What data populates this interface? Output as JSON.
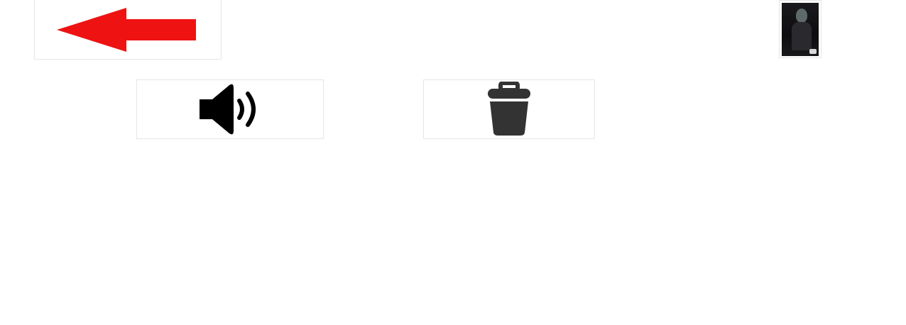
{
  "toolbar": {
    "back_icon": "arrow-left-icon",
    "speak_icon": "speaker-volume-icon",
    "delete_icon": "trash-icon",
    "thumbnail_icon": "photo-thumbnail"
  },
  "colors": {
    "back_arrow": "#ef1212",
    "icon_dark": "#333333",
    "icon_black": "#000000",
    "tile_border": "#e6e6e6"
  }
}
